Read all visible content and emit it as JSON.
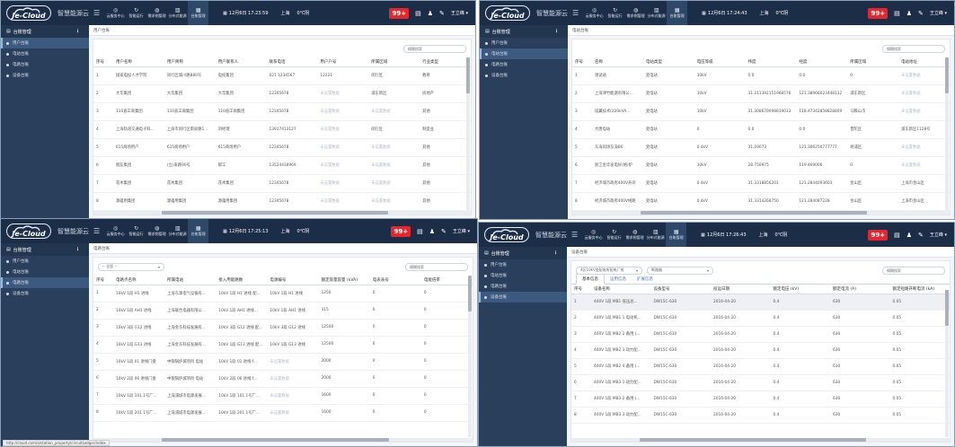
{
  "brand": {
    "logo_text": "Je-Cloud",
    "name": "智慧能源云",
    "menu_icon": "hamburger-icon"
  },
  "nav_items": [
    {
      "label": "云服务中心",
      "icon": "compass-icon"
    },
    {
      "label": "智能运行",
      "icon": "refresh-icon"
    },
    {
      "label": "需求侧管理",
      "icon": "drop-icon"
    },
    {
      "label": "分布式能源",
      "icon": "chart-icon"
    },
    {
      "label": "台账管理",
      "icon": "grid-icon"
    }
  ],
  "header": {
    "city": "上海",
    "weather": "0℃阴",
    "alert_count": "99+",
    "user": "王立峰"
  },
  "sidebar": {
    "title": "台账管理",
    "items": [
      "用户台账",
      "电站台账",
      "电路台账",
      "设备台账"
    ]
  },
  "colors": {
    "topbar": "#1c2e47",
    "sidebar": "#2a3f5c",
    "sidebar_active": "#3c5a80",
    "alert": "#e5262e"
  },
  "windows": [
    {
      "date": "12月6日 17:23:59",
      "active_nav": 4,
      "active_side": 0,
      "crumb": "用户台账",
      "search_placeholder": "模糊搜索",
      "columns": [
        "序号",
        "用户名称",
        "用户简称",
        "用户联系人",
        "联系电话",
        "用户户号",
        "所属区域",
        "行业类型"
      ],
      "rows": [
        [
          "1",
          "国家电投人才学院",
          "闵行区城川路880号",
          "电投集团",
          "021 1234567",
          "12221",
          "闵行区",
          "教育"
        ],
        [
          "2",
          "大华集团",
          "大华集团",
          "大华集团",
          "12345678",
          "未设置数据",
          "浦东新区",
          "房地产"
        ],
        [
          "3",
          "110直工商集团",
          "110直工商集团",
          "110直工商集团",
          "12345678",
          "未设置数据",
          "未设置数据",
          "其他"
        ],
        [
          "4",
          "上海轨道交通电子科...",
          "上海市闵行区南泉路1...",
          "刘经理",
          "13917413127",
          "未设置数据",
          "闵行区",
          "制造业"
        ],
        [
          "5",
          "615商场用户",
          "615商场用户",
          "615商场用户",
          "12345678",
          "未设置数据",
          "未设置数据",
          "其他"
        ],
        [
          "6",
          "朋友集团",
          "(立)发路90号",
          "郁工",
          "13524438969",
          "未设置数据",
          "未设置数据",
          "其他"
        ],
        [
          "7",
          "花木集团",
          "花木集团",
          "花木集团",
          "12345678",
          "未设置数据",
          "未设置数据",
          "其他"
        ],
        [
          "8",
          "源蕴用集团",
          "源蕴用集团",
          "源蕴用集团",
          "12345678",
          "未设置数据",
          "未设置数据",
          "其他"
        ]
      ]
    },
    {
      "date": "12月6日 17:24:43",
      "active_nav": 4,
      "active_side": 1,
      "crumb": "电站台账",
      "search_placeholder": "模糊搜索",
      "columns": [
        "序号",
        "名称",
        "电站类型",
        "电压等级",
        "纬度",
        "经度",
        "所属区域",
        "电站地址"
      ],
      "rows": [
        [
          "1",
          "测试站",
          "变电站",
          "10kV",
          "0.0",
          "0.0",
          "0",
          "未设置数据"
        ],
        [
          "2",
          "上海津竹能源有限公...",
          "变电站",
          "10kV",
          "31.211392151968576",
          "121.38966023448132",
          "浦东新区",
          "未设置数据"
        ],
        [
          "3",
          "炫翼技术(220kVA...",
          "变电站",
          "10kV",
          "31.308670098819033",
          "118.47342858828809",
          "马鞍山市",
          "未设置数据"
        ],
        [
          "4",
          "大唐电站",
          "变电站",
          "0",
          "0.0",
          "0.0",
          "普陀区",
          "浦东新区1128号"
        ],
        [
          "5",
          "东海风场东海B6",
          "变电站",
          "0.4kV",
          "31.29073",
          "121.306250777777",
          "杨浦区",
          "未设置数据"
        ],
        [
          "6",
          "浙江金华发电好(格)炉",
          "变电站",
          "10kV",
          "28.750975",
          "119.469006",
          "0",
          "未设置数据"
        ],
        [
          "7",
          "经济城市政府400V开闭",
          "变电站",
          "0.4kV",
          "31.3318856201",
          "121.2844093603",
          "金山区",
          "上海市金山区"
        ],
        [
          "8",
          "经济城市政府400V线路",
          "变电站",
          "0.4kV",
          "31.3314268750",
          "121.284087228",
          "金山区",
          "上海市金山区"
        ]
      ]
    },
    {
      "date": "12月6日 17:25:13",
      "active_nav": 4,
      "active_side": 2,
      "crumb": "电路台账",
      "filter_value": "-- 全部 --",
      "search_placeholder": "模糊搜索",
      "status_url": "http://cloud.com/a/station_property/circuitLedger/index",
      "columns": [
        "序号",
        "电路点名称",
        "所属电站",
        "接入用能路数",
        "电源编号",
        "额定容量容量 (kVA)",
        "电表表号",
        "电能倍率"
      ],
      "rows": [
        [
          "1",
          "10kV 1段 H1 进线",
          "上海东源电气设备有...",
          "10kV 1段 H1 进线 配...",
          "10kV 1段 H1 进线",
          "1250",
          "0",
          "0"
        ],
        [
          "2",
          "10kV 1段 AH1 进线",
          "上海联合电器有限公...",
          "10kV 1段 AH1 进线...",
          "10kV 1段 AH1 进线",
          "315",
          "0",
          "0"
        ],
        [
          "3",
          "10kV 3段 G12 进线",
          "上海金东科技发展有...",
          "10kV 3段 G12 进线 配...",
          "10kV 3段 G12 进线",
          "12500",
          "0",
          "0"
        ],
        [
          "4",
          "10kV 1段 G13 进线",
          "上海金东科技发展有...",
          "10kV 1段 G13 进线 配...",
          "10kV 1段 G13 进线",
          "12500",
          "0",
          "0"
        ],
        [
          "5",
          "10kV 1段 01 进线门盘",
          "中银锅炉城项目 电站",
          "10kV 1段 01 进线 f...",
          "未设置数据",
          "2000",
          "0",
          "0"
        ],
        [
          "6",
          "10kV 2段 06 进线门盘",
          "中银锅炉城项目 电站",
          "10kV 2段 06 进线 f...",
          "未设置数据",
          "2000",
          "0",
          "0"
        ],
        [
          "7",
          "10kV 1段 101 1号厂...",
          "上海浦城市电源发展...",
          "10kV 1段 101 1号厂...",
          "未设置数据",
          "1600",
          "0",
          "0"
        ],
        [
          "8",
          "10kV 1段 201 1号厂...",
          "上海浦城市电源发展...",
          "10kV 1段 201 1号厂...",
          "未设置数据",
          "1600",
          "0",
          "0"
        ]
      ]
    },
    {
      "date": "12月6日 17:26:43",
      "active_nav": 4,
      "active_side": 3,
      "crumb": "设备台账",
      "filter_value": "4区10kV变配电所配电厂房",
      "filter2_value": "断路器",
      "search_placeholder": "模糊搜索",
      "tabs": [
        "基本信息",
        "运用信息",
        "扩展信息"
      ],
      "columns": [
        "序号",
        "设备名称",
        "设备型号",
        "投运日期",
        "额定电压 (kV)",
        "额定电流 (A)",
        "额定短路开断电流 (kA)"
      ],
      "rows": [
        [
          "1",
          "400V 1段 MB1 低压总...",
          "DW15C-630",
          "2016-04-20",
          "0.4",
          "630",
          "0.05"
        ],
        [
          "2",
          "400V 1段 MB1 1 电动机...",
          "DW15C-630",
          "2016-04-20",
          "0.4",
          "630",
          "0.05"
        ],
        [
          "3",
          "400V 1段 MB2 2 备用 (...",
          "DW15C-630",
          "2016-04-20",
          "0.4",
          "630",
          "0.05"
        ],
        [
          "4",
          "400V 1段 MB2 3 动力配...",
          "DW15C-630",
          "2016-04-20",
          "0.4",
          "630",
          "0.05"
        ],
        [
          "5",
          "400V 1段 MB2 4 备用 (...",
          "DW15C-630",
          "2016-04-20",
          "0.4",
          "630",
          "0.05"
        ],
        [
          "6",
          "400V 1段 MB3 1 动力配...",
          "DW15C-630",
          "2016-04-20",
          "0.4",
          "630",
          "0.05"
        ],
        [
          "7",
          "400V 1段 MB3 2 备用 (...",
          "DW15C-630",
          "2016-04-20",
          "0.4",
          "630",
          "0.05"
        ],
        [
          "8",
          "400V 1段 MB3 3 动力配...",
          "DW15C-630",
          "2016-04-20",
          "0.4",
          "630",
          "0.05"
        ]
      ]
    }
  ]
}
